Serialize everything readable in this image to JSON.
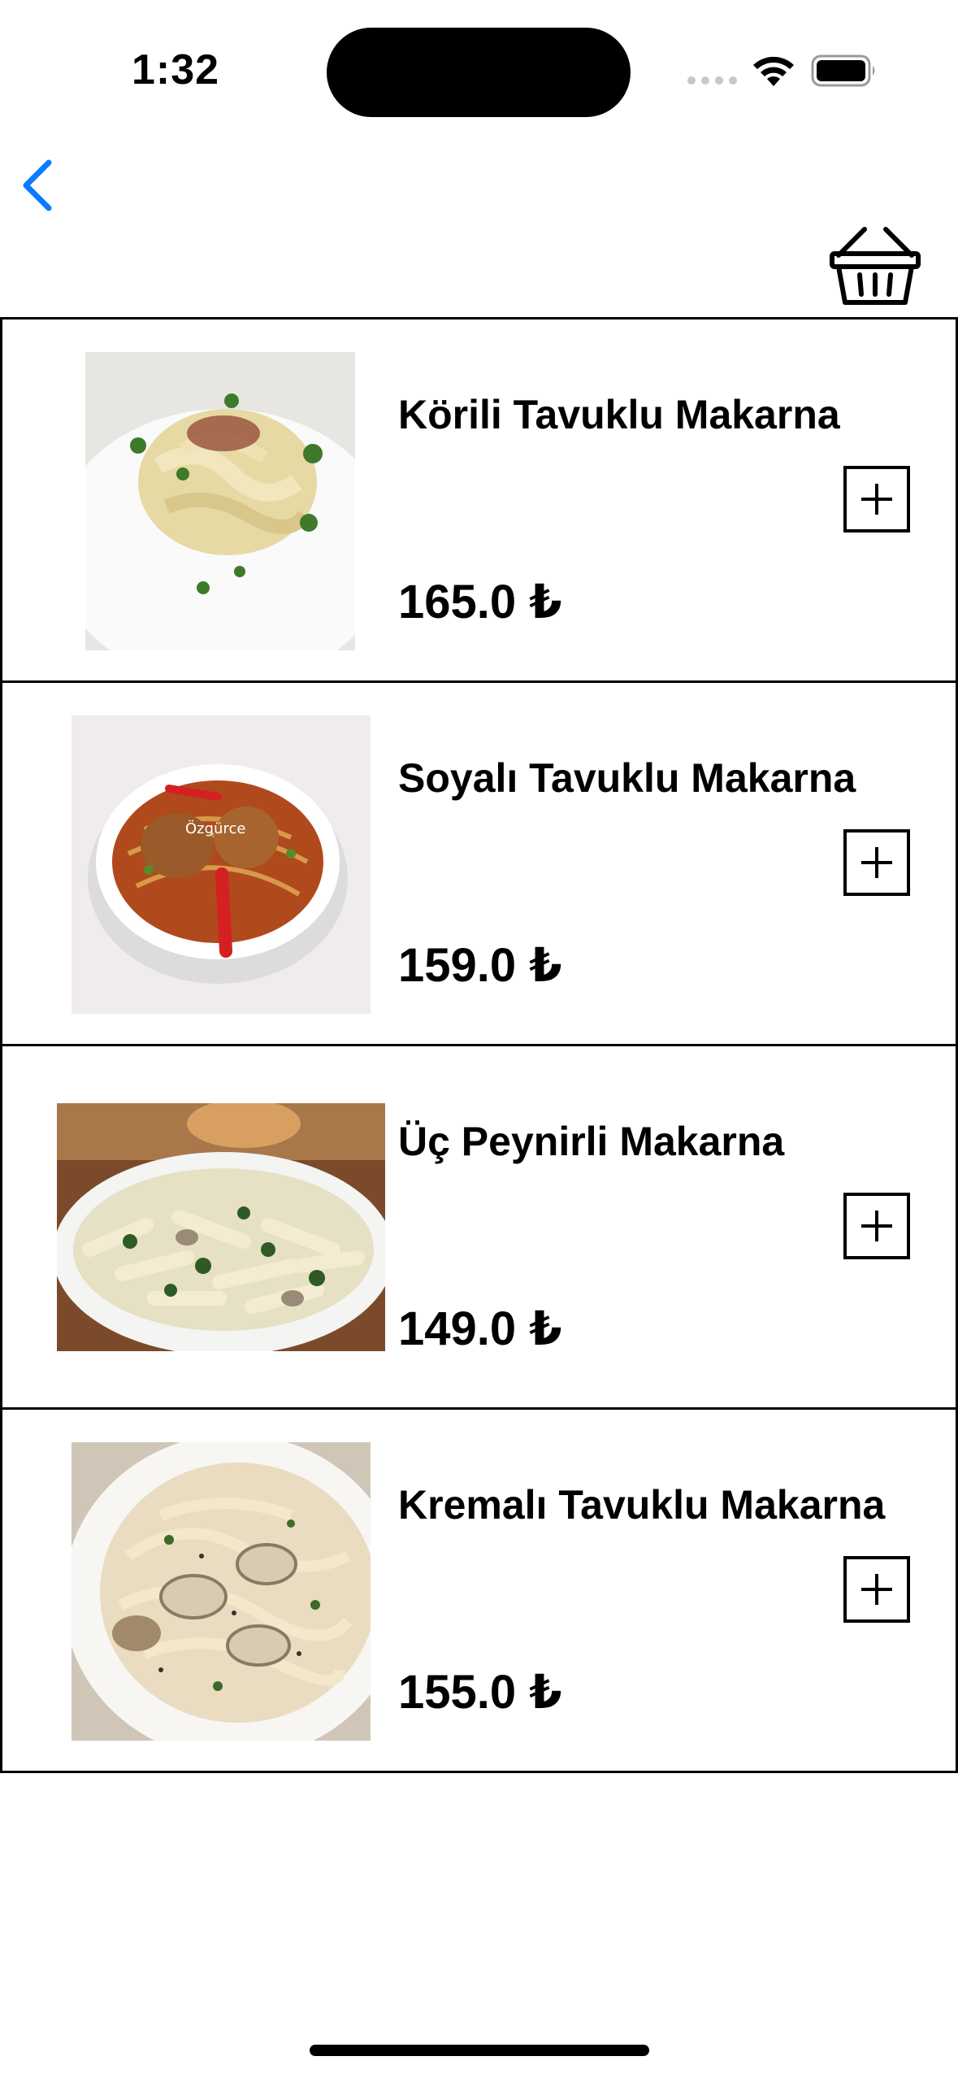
{
  "status_bar": {
    "time": "1:32"
  },
  "nav": {
    "back_icon": "chevron-left-icon",
    "basket_icon": "basket-icon",
    "accent_color": "#0a7aff"
  },
  "menu": {
    "items": [
      {
        "name": "Körili Tavuklu Makarna",
        "price": "165.0 ₺",
        "image": "curry-chicken-pasta"
      },
      {
        "name": "Soyalı Tavuklu Makarna",
        "price": "159.0 ₺",
        "image": "soy-chicken-pasta",
        "watermark": "Özgürce"
      },
      {
        "name": "Üç Peynirli Makarna",
        "price": "149.0 ₺",
        "image": "three-cheese-pasta"
      },
      {
        "name": "Kremalı Tavuklu Makarna",
        "price": "155.0 ₺",
        "image": "creamy-chicken-pasta"
      }
    ]
  }
}
